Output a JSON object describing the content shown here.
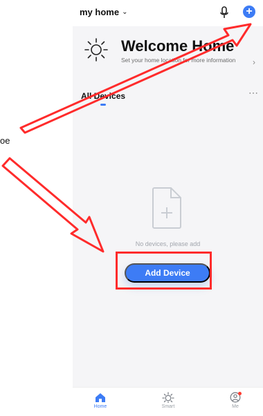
{
  "header": {
    "home_name": "my home",
    "dropdown_icon": "chevron-down-icon",
    "mic_icon": "mic-icon",
    "add_icon": "plus-circle-icon"
  },
  "welcome": {
    "title": "Welcome Home",
    "subtitle": "Set your home location for more information",
    "icon": "sun-icon",
    "chevron_icon": "chevron-right-icon"
  },
  "devices": {
    "section_title": "All Devices",
    "more_icon": "more-icon",
    "empty_message": "No devices, please add",
    "add_button_label": "Add Device",
    "empty_icon": "file-plus-icon"
  },
  "nav": {
    "items": [
      {
        "label": "Home",
        "icon": "home-icon"
      },
      {
        "label": "Smart",
        "icon": "sun-icon"
      },
      {
        "label": "Me",
        "icon": "user-icon"
      }
    ]
  },
  "overlay": {
    "left_text": "oe"
  },
  "colors": {
    "accent": "#3d7cf5",
    "background": "#f5f5f7",
    "annotation": "#ff2b2b"
  }
}
